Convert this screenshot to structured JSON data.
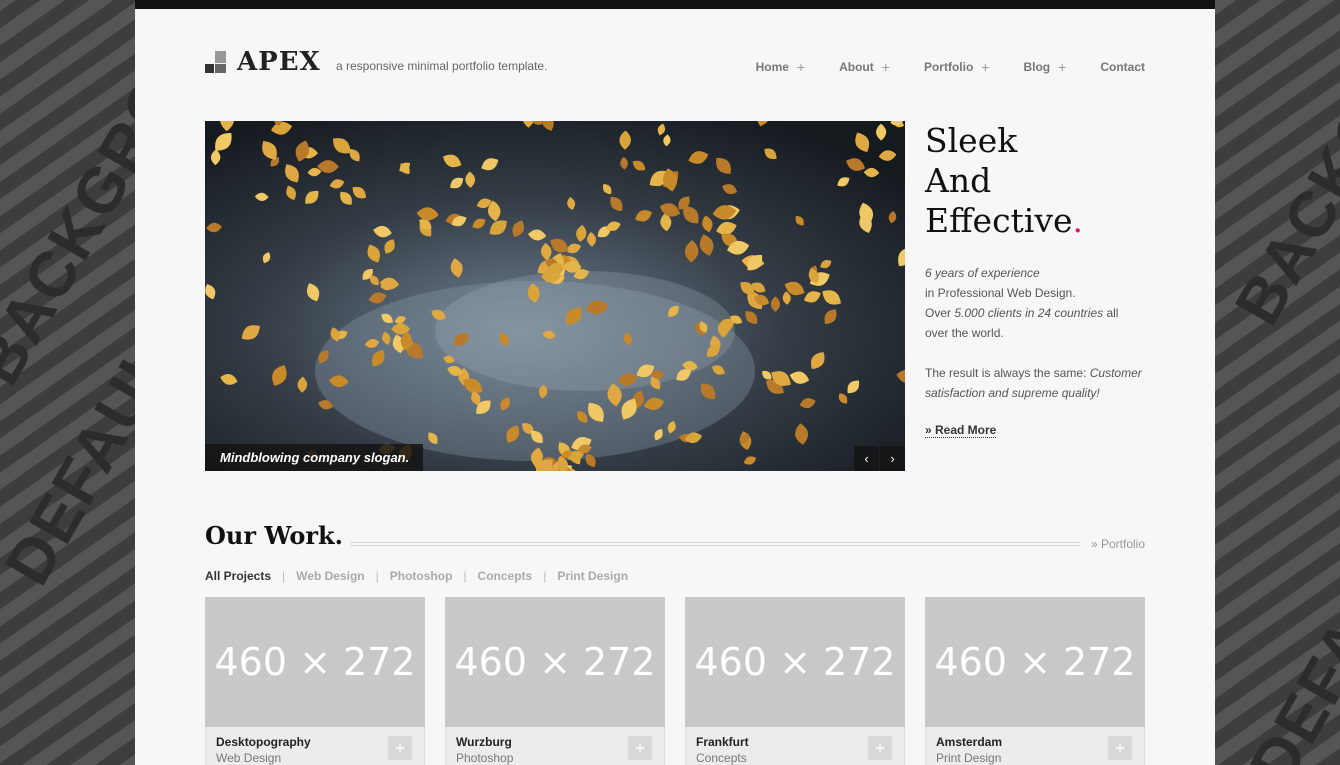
{
  "background": {
    "words": [
      "DEFAULT",
      "BACKGROUND"
    ],
    "color": "#4a4a4a"
  },
  "header": {
    "logo_text": "APEX",
    "tagline": "a responsive minimal portfolio template."
  },
  "nav": {
    "items": [
      {
        "label": "Home",
        "submenu": "+"
      },
      {
        "label": "About",
        "submenu": "+"
      },
      {
        "label": "Portfolio",
        "submenu": "+"
      },
      {
        "label": "Blog",
        "submenu": "+"
      },
      {
        "label": "Contact",
        "submenu": ""
      }
    ]
  },
  "hero": {
    "slogan": "Mindblowing company slogan.",
    "prev": "‹",
    "next": "›"
  },
  "intro": {
    "headline_1": "Sleek",
    "headline_2": "And",
    "headline_3": "Effective",
    "headline_dot": ".",
    "accent_color": "#e0156a",
    "years": "6 years of experience",
    "line2": "in Professional Web Design.",
    "over": "Over",
    "clients": "5.000 clients in 24 countries",
    "all": "all",
    "world": "over the world.",
    "result": "The result is always the same:",
    "quote": "Customer satisfaction and supreme quality!",
    "read_more": "» Read More"
  },
  "work": {
    "title": "Our Work.",
    "portfolio_link": "» Portfolio",
    "filters": [
      "All Projects",
      "Web Design",
      "Photoshop",
      "Concepts",
      "Print Design"
    ],
    "separator": "|",
    "projects": [
      {
        "placeholder": "460 × 272",
        "title": "Desktopography",
        "category": "Web Design",
        "plus": "+"
      },
      {
        "placeholder": "460 × 272",
        "title": "Wurzburg",
        "category": "Photoshop",
        "plus": "+"
      },
      {
        "placeholder": "460 × 272",
        "title": "Frankfurt",
        "category": "Concepts",
        "plus": "+"
      },
      {
        "placeholder": "460 × 272",
        "title": "Amsterdam",
        "category": "Print Design",
        "plus": "+"
      }
    ]
  }
}
